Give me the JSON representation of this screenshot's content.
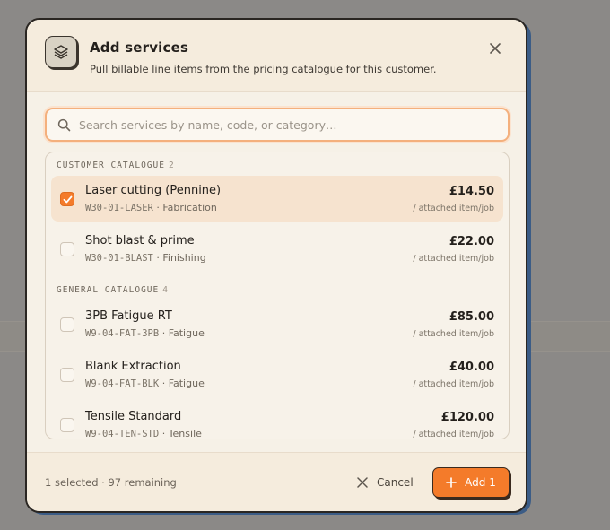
{
  "dialog": {
    "title": "Add services",
    "subtitle": "Pull billable line items from the pricing catalogue for this customer."
  },
  "search": {
    "placeholder": "Search services by name, code, or category…"
  },
  "groups": [
    {
      "label": "CUSTOMER CATALOGUE",
      "count": "2",
      "items": [
        {
          "name": "Laser cutting (Pennine)",
          "code": "W30-01-LASER",
          "category": "Fabrication",
          "price": "£14.50",
          "unit": "/ attached item/job",
          "checked": true
        },
        {
          "name": "Shot blast & prime",
          "code": "W30-01-BLAST",
          "category": "Finishing",
          "price": "£22.00",
          "unit": "/ attached item/job",
          "checked": false
        }
      ]
    },
    {
      "label": "GENERAL CATALOGUE",
      "count": "4",
      "items": [
        {
          "name": "3PB Fatigue RT",
          "code": "W9-04-FAT-3PB",
          "category": "Fatigue",
          "price": "£85.00",
          "unit": "/ attached item/job",
          "checked": false
        },
        {
          "name": "Blank Extraction",
          "code": "W9-04-FAT-BLK",
          "category": "Fatigue",
          "price": "£40.00",
          "unit": "/ attached item/job",
          "checked": false
        },
        {
          "name": "Tensile Standard",
          "code": "W9-04-TEN-STD",
          "category": "Tensile",
          "price": "£120.00",
          "unit": "/ attached item/job",
          "checked": false
        }
      ]
    }
  ],
  "footer": {
    "status": "1 selected · 97 remaining",
    "cancel_label": "Cancel",
    "add_label": "Add 1"
  },
  "separator": "·",
  "colors": {
    "accent": "#f47b2a",
    "selected_row": "#f6e3cf",
    "modal_bg": "#f6f1e7"
  },
  "icons": {
    "header": "layers-icon",
    "close": "close-icon",
    "search": "search-icon",
    "check": "check-icon",
    "cancel": "close-icon",
    "add": "plus-icon"
  }
}
